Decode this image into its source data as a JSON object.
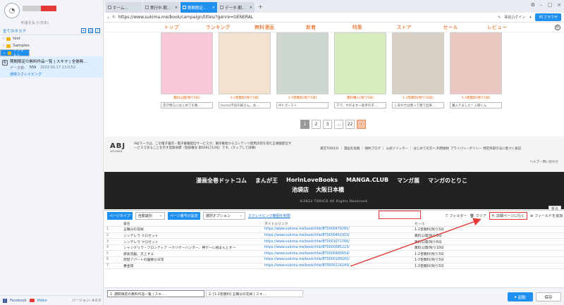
{
  "sidebar": {
    "user_sub": "料金を払う(日本)",
    "toolbar_label": "全てのタスク",
    "tree": [
      {
        "label": "test"
      },
      {
        "label": "Samples"
      },
      {
        "label": "デフォルト"
      }
    ],
    "task": {
      "title": "期間限定の無料作品一覧 | スキマ | 全巻無...",
      "count_label": "データ数:",
      "count": "559",
      "time": "2022-01-17 13:0:52",
      "status": "通常スクレイピング"
    },
    "facebook": "Facebook",
    "video": "Video",
    "version": "バージョン: 4.0.0"
  },
  "tabs": [
    {
      "label": "ホーム..."
    },
    {
      "label": "実行中:期..."
    },
    {
      "label": "期間限定..."
    },
    {
      "label": "データ:期..."
    }
  ],
  "urlbar": {
    "url": "https://www.sukima.me/book/campaign/titles/?genre=GENERAL",
    "login": "事前ログイン",
    "pc_browser": "PCブラウザ"
  },
  "site": {
    "nav": [
      "トップ",
      "ランキング",
      "無料漫画",
      "新着",
      "特集",
      "ストア",
      "セール",
      "レビュー"
    ],
    "books": [
      {
        "tag": "無料公開(残り5日)",
        "input": "恋が僕らにはじめてを教...",
        "color": "#f6c8d6"
      },
      {
        "tag": "1-2巻無料(残り5日)",
        "input": "tocoro不良の嫁さん、お...",
        "color": "#f3e2d0"
      },
      {
        "tag": "1-3巻無料(残り5日)",
        "input": "Mドゴースト",
        "color": "#cfd8cf"
      },
      {
        "tag": "無料購入(残り5日)",
        "input": "ママ、やのますー助手の子...",
        "color": "#d7ecbf"
      },
      {
        "tag": "1-2巻無料(残り10日)",
        "input": "しあわせは僕って僕で出来...",
        "color": "#d8d0c4"
      },
      {
        "tag": "1-3巻無料(残り5日)",
        "input": "魔入りました！入間くん",
        "color": "#e9c7c0"
      }
    ],
    "pager": [
      "1",
      "2",
      "3",
      "...",
      "22",
      "›"
    ],
    "adj_logo": "ABJ",
    "adj_code": "10121001",
    "adj_text": "ABJマークは、この電子書店・電子書籍配信サービスが、著作権者からコンテンツ使用許諾を得た正規版配信サービスであることを示す登録商標（登録番号 第6091713号）です。(タップして詳細)",
    "footer_links": "運営TORICO ｜ 漫画を投稿 ｜ 規約ブログ ｜ 公式ツイッター ｜ はじめての方へ 利用規約 プライバシーポリシー 特定商取引法に基づく表記",
    "help": "ヘルプ・問い合わせ",
    "brands": [
      "漫画全巻ドットコム",
      "まんが王",
      "HorinLoveBooks",
      "MANGA.CLUB",
      "マンガ展",
      "マンガのとりこ"
    ],
    "brands2": [
      "池袋店",
      "大阪日本橋"
    ],
    "copyright": "©2022 TORICO All Rights Reserved.",
    "collapse": "折る"
  },
  "panel": {
    "page_type_label": "ページタイプ",
    "page_type_value": "自動識別",
    "page_no_label": "ページ番号の設定",
    "page_no_value": "選択オプション",
    "scrape_link": "スクレイピング範囲を制限",
    "filter": "フィルター",
    "clear": "クリア",
    "detail": "詳細ページに行く",
    "add_field": "フィールドを追加",
    "columns": [
      "",
      "書名",
      "タイトルリンク",
      "セール"
    ],
    "rows": [
      [
        "1",
        "五種分の花嫁",
        "https://www.sukima.me/book/title/BT0000479281/",
        "1-2巻無料(残り3日"
      ],
      [
        "2",
        "シンデレラ クロゼット",
        "https://www.sukima.me/book/title/BT0000461919/",
        "無料公開(残り6日"
      ],
      [
        "3",
        "シンデレラ クロゼット",
        "https://www.sukima.me/book/title/BT0001071766/",
        "無料公開(残り6日"
      ],
      [
        "4",
        "シャングリラ・フロンティア ～クソゲーハンター、神ゲーに挑まんとす～",
        "https://www.sukima.me/book/title/BT0000085223/",
        "無料公開(残り10日"
      ],
      [
        "5",
        "部長洗脳、次上する",
        "https://www.sukima.me/book/title/BT0000480654/",
        "1-2巻無料(残り3日"
      ],
      [
        "6",
        "琵琶アパートの幽微な日常",
        "https://www.sukima.me/book/title/BT0000189165/",
        "1-3巻無料(残り3日"
      ],
      [
        "7",
        "黄金旅",
        "https://www.sukima.me/book/title/BT0000124249/",
        "1-3巻無料(残り3日"
      ]
    ]
  },
  "bottombar": {
    "tabs": [
      "1. 期間限定の無料作品一覧 | スキ...",
      "2. [1-2巻無料] 五種分の花嫁 | スキ..."
    ],
    "start": "起動",
    "save": "保存"
  },
  "colors": {
    "accent": "#1f8ff0",
    "annotation": "#e53935",
    "site_orange": "#e65a00"
  }
}
